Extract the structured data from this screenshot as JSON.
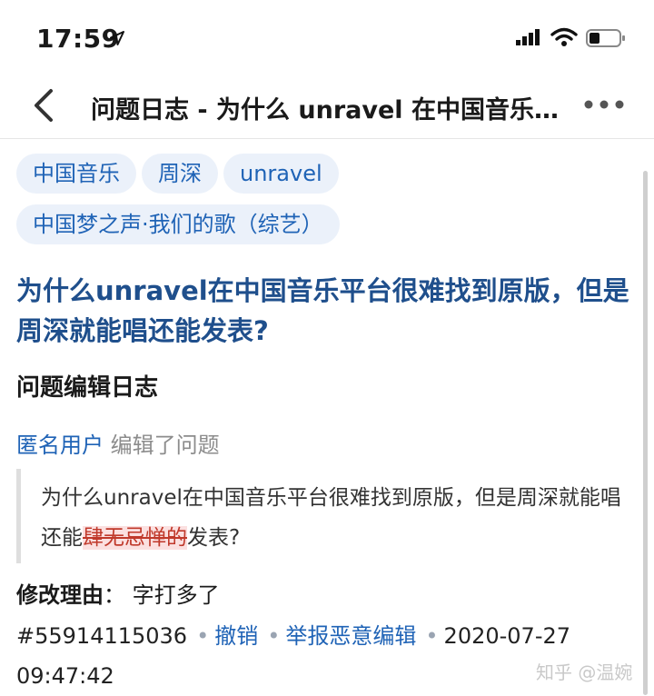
{
  "status_bar": {
    "time": "17:59"
  },
  "nav": {
    "title": "问题日志 - 为什么 unravel 在中国音乐…"
  },
  "tags": [
    "中国音乐",
    "周深",
    "unravel",
    "中国梦之声·我们的歌（综艺）"
  ],
  "question": {
    "title": "为什么unravel在中国音乐平台很难找到原版，但是周深就能唱还能发表?"
  },
  "section": {
    "title": "问题编辑日志"
  },
  "log": {
    "user": "匿名用户",
    "action": "编辑了问题",
    "text_before": "为什么unravel在中国音乐平台很难找到原版，但是周深就能唱还能",
    "text_deleted": "肆无忌惮的",
    "text_after": "发表?",
    "reason_label": "修改理由",
    "reason_sep": "：",
    "reason_text": "字打多了",
    "id": "#55914115036",
    "undo_label": "撤销",
    "report_label": "举报恶意编辑",
    "date": "2020-07-27",
    "time": "09:47:42"
  },
  "watermark": "知乎 @温婉",
  "icons": {
    "back": "back-icon",
    "more": "more-icon",
    "location": "location-arrow-icon",
    "signal": "signal-icon",
    "wifi": "wifi-icon",
    "battery": "battery-icon"
  }
}
